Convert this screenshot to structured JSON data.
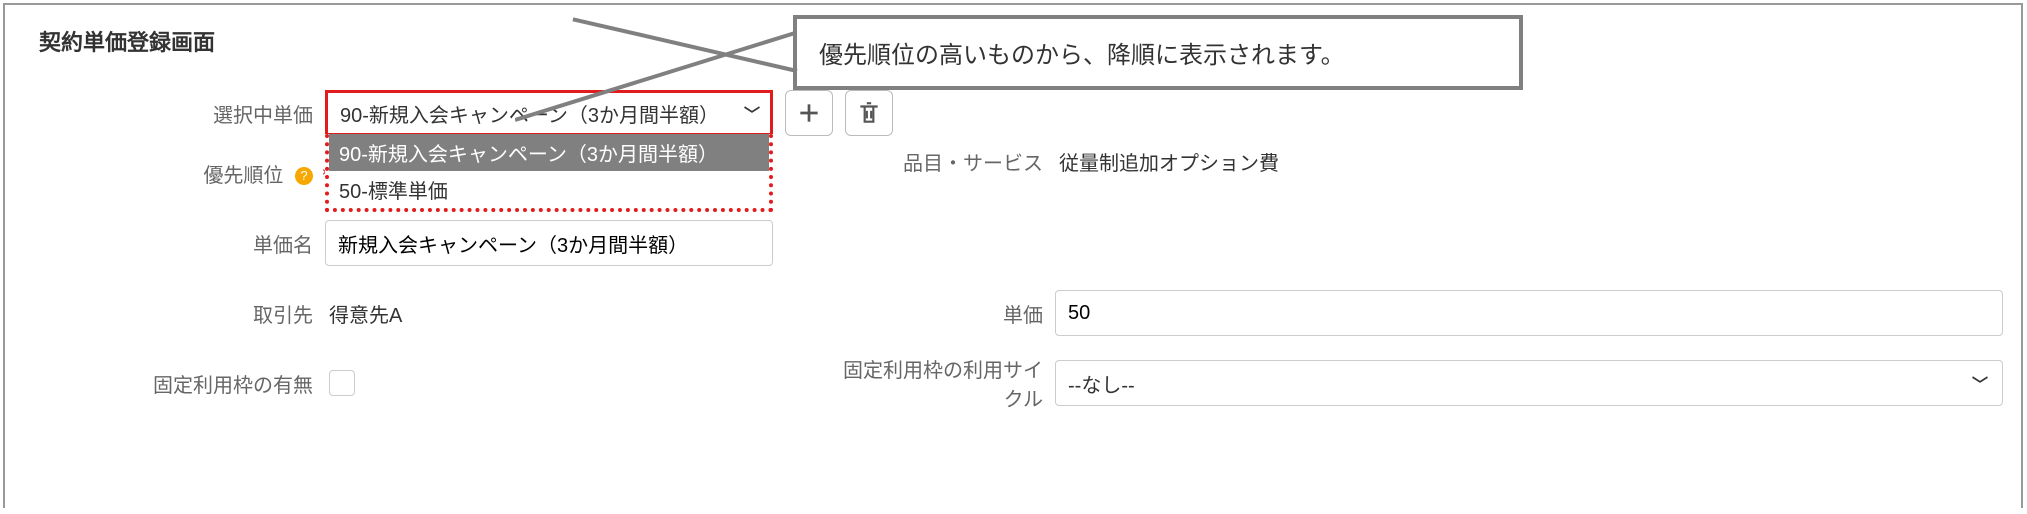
{
  "title": "契約単価登録画面",
  "callout": "優先順位の高いものから、降順に表示されます。",
  "labels": {
    "selected_unitprice": "選択中単価",
    "priority": "優先順位",
    "unitprice_name": "単価名",
    "customer": "取引先",
    "item_service": "品目・サービス",
    "unit_price": "単価",
    "fixed_slot": "固定利用枠の有無",
    "fixed_cycle": "固定利用枠の利用サイクル"
  },
  "selected_unitprice": {
    "current": "90-新規入会キャンペーン（3か月間半額）",
    "options": [
      "90-新規入会キャンペーン（3か月間半額）",
      "50-標準単価"
    ]
  },
  "priority": "",
  "unitprice_name": "新規入会キャンペーン（3か月間半額）",
  "customer": "得意先A",
  "item_service": "従量制追加オプション費",
  "unit_price": "50",
  "fixed_slot_checked": false,
  "fixed_cycle": "--なし--"
}
